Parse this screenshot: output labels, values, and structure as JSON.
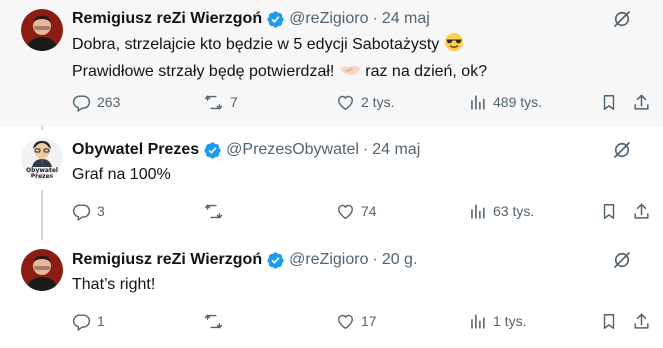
{
  "tweets": [
    {
      "name": "Remigiusz reZi Wierzgoń",
      "handle": "@reZigioro",
      "separator": "·",
      "time": "24 maj",
      "line1": "Dobra, strzelajcie kto będzie w 5 edycji Sabotażysty",
      "line2a": "Prawidłowe strzały będę potwierdzał!",
      "line2b": "raz na dzień, ok?",
      "replies": "263",
      "reposts": "7",
      "likes": "2 tys.",
      "views": "489 tys.",
      "avatar": "man-portrait",
      "emoji1": "sunglasses-face",
      "emoji2": "handshake"
    },
    {
      "name": "Obywatel Prezes",
      "handle": "@PrezesObywatel",
      "separator": "·",
      "time": "24 maj",
      "text": "Graf na 100%",
      "replies": "3",
      "reposts": "",
      "likes": "74",
      "views": "63 tys.",
      "avatar": "cartoon-man-logo",
      "avatar_label_1": "Obywatel",
      "avatar_label_2": "Prezes"
    },
    {
      "name": "Remigiusz reZi Wierzgoń",
      "handle": "@reZigioro",
      "separator": "·",
      "time": "20 g.",
      "text": "That’s right!",
      "replies": "1",
      "reposts": "",
      "likes": "17",
      "views": "1 tys.",
      "avatar": "man-portrait"
    }
  ],
  "colors": {
    "verified": "#1d9bf0",
    "muted": "#536471",
    "thread_line": "#cfd9de",
    "highlight_bg": "#f7f7f7"
  },
  "icons": [
    "reply-icon",
    "repost-icon",
    "like-icon",
    "views-icon",
    "bookmark-icon",
    "share-icon",
    "grok-icon",
    "verified-badge-icon"
  ]
}
